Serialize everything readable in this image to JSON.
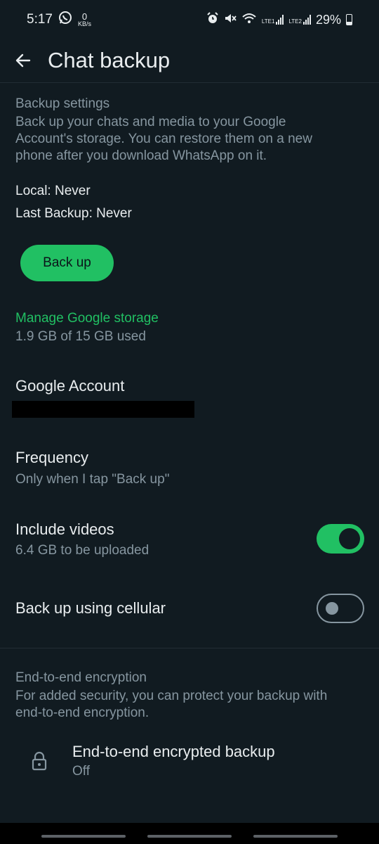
{
  "status_bar": {
    "time": "5:17",
    "net_speed_value": "0",
    "net_speed_unit": "KB/s",
    "sim1": "LTE1",
    "sim2": "LTE2",
    "battery": "29%"
  },
  "app_bar": {
    "title": "Chat backup"
  },
  "backup_settings": {
    "heading": "Backup settings",
    "description_line1": "Back up your chats and media to your Google",
    "description_line2": "Account's storage. You can restore them on a new",
    "description_line3": "phone after you download WhatsApp on it.",
    "local": "Local: Never",
    "last_backup": "Last Backup: Never",
    "back_up_label": "Back up"
  },
  "storage": {
    "manage_label": "Manage Google storage",
    "usage": "1.9 GB of 15 GB used"
  },
  "google_account": {
    "title": "Google Account"
  },
  "frequency": {
    "title": "Frequency",
    "value": "Only when I tap \"Back up\""
  },
  "include_videos": {
    "title": "Include videos",
    "subtitle": "6.4 GB to be uploaded",
    "enabled": true
  },
  "cellular": {
    "title": "Back up using cellular",
    "enabled": false
  },
  "encryption": {
    "heading": "End-to-end encryption",
    "description_line1": "For added security, you can protect your backup with",
    "description_line2": "end-to-end encryption.",
    "item_title": "End-to-end encrypted backup",
    "item_value": "Off"
  },
  "icons": {
    "back": "arrow-left-icon",
    "lock": "lock-icon",
    "whatsapp": "whatsapp-icon",
    "alarm": "alarm-icon",
    "mute": "mute-icon",
    "wifi": "wifi-icon"
  },
  "colors": {
    "background": "#111b21",
    "accent": "#21c063",
    "text_primary": "#e9edef",
    "text_secondary": "#8696a0"
  }
}
